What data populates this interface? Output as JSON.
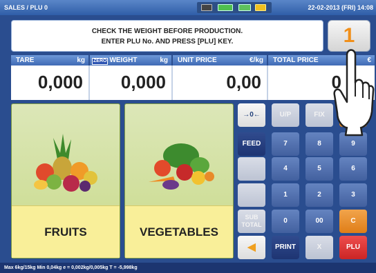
{
  "header": {
    "mode": "SALES / PLU 0",
    "datetime": "22-02-2013 (FRI) 14:08",
    "status_icons": [
      "monitor-icon",
      "screen-icon",
      "battery-icon",
      "cable-icon"
    ]
  },
  "message": {
    "line1": "CHECK THE WEIGHT BEFORE PRODUCTION.",
    "line2": "ENTER PLU No. AND PRESS [PLU] KEY."
  },
  "key_button": {
    "label": "1"
  },
  "displays": {
    "tare": {
      "label": "TARE",
      "unit": "kg",
      "value": "0,000"
    },
    "weight": {
      "badge": "ZERO",
      "label": "WEIGHT",
      "unit": "kg",
      "value": "0,000"
    },
    "unit_price": {
      "label": "UNIT PRICE",
      "unit": "€/kg",
      "value": "0,00"
    },
    "total_price": {
      "label": "TOTAL PRICE",
      "unit": "€",
      "value": "0"
    }
  },
  "categories": [
    {
      "label": "FRUITS",
      "icon": "fruits-icon"
    },
    {
      "label": "VEGETABLES",
      "icon": "vegetables-icon"
    }
  ],
  "keys": {
    "zero_set": "→0←",
    "up": "U/P",
    "fix": "FIX",
    "feed": "FEED",
    "n7": "7",
    "n8": "8",
    "n9": "9",
    "n4": "4",
    "n5": "5",
    "n6": "6",
    "n1": "1",
    "n2": "2",
    "n3": "3",
    "subtotal_line1": "SUB",
    "subtotal_line2": "TOTAL",
    "n0": "0",
    "n00": "00",
    "clear": "C",
    "back": "◀",
    "print": "PRINT",
    "x": "X",
    "plu": "PLU"
  },
  "footer": {
    "text": "Max 6kg/15kg  Min 0,04kg  e = 0,002kg/0,005kg  T = -5,998kg"
  }
}
